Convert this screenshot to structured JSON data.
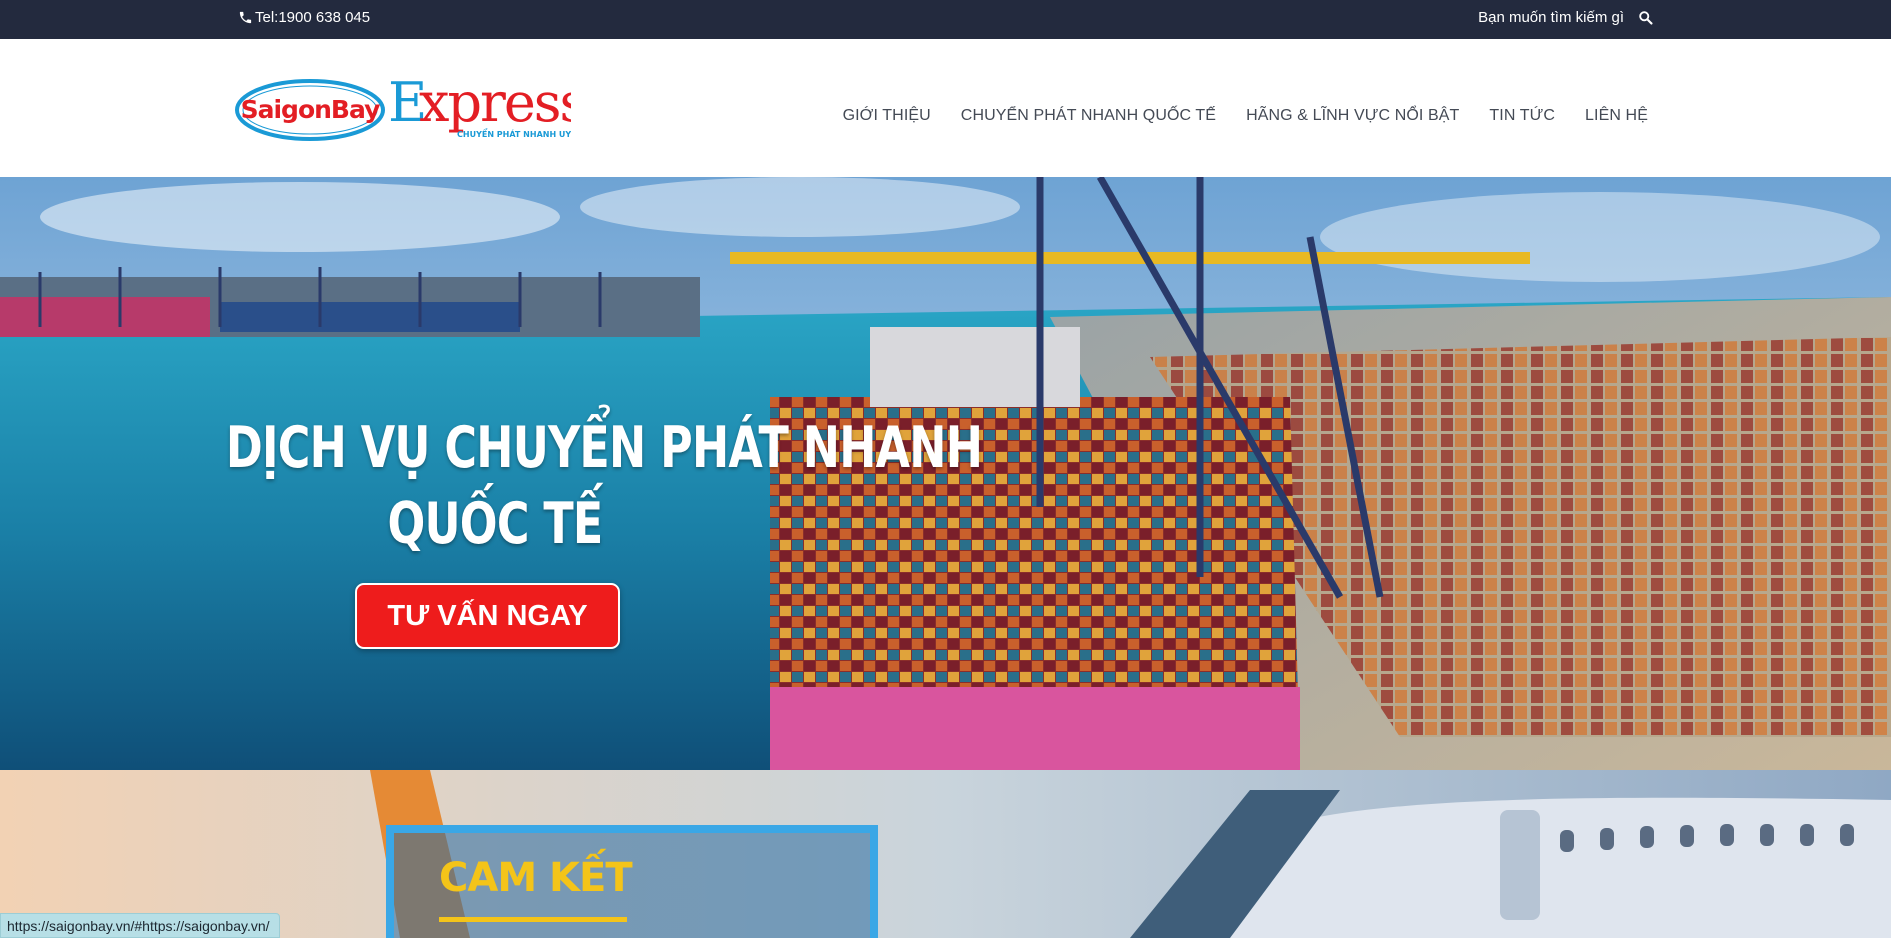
{
  "topbar": {
    "phone": "Tel:1900 638 045",
    "search_label": "Bạn muốn tìm kiếm gì"
  },
  "logo": {
    "brand": "SaigonBay",
    "express": "Express",
    "tagline": "CHUYỂN PHÁT NHANH UY TÍN"
  },
  "nav": {
    "items": [
      {
        "label": "GIỚI THIỆU"
      },
      {
        "label": "CHUYỂN PHÁT NHANH QUỐC TẾ"
      },
      {
        "label": "HÃNG & LĨNH VỰC NỔI BẬT"
      },
      {
        "label": "TIN TỨC"
      },
      {
        "label": "LIÊN HỆ"
      }
    ]
  },
  "hero": {
    "title_line1": "DỊCH VỤ CHUYỂN PHÁT NHANH",
    "title_line2": "QUỐC TẾ",
    "cta": "TƯ VẤN NGAY"
  },
  "section2": {
    "commit_title": "CAM KẾT"
  },
  "status_url": "https://saigonbay.vn/#https://saigonbay.vn/",
  "colors": {
    "topbar_bg": "#232a3e",
    "cta_red": "#ee1c1c",
    "logo_red": "#e31e24",
    "logo_blue": "#1a9ad6",
    "commit_yellow": "#f4c419"
  }
}
